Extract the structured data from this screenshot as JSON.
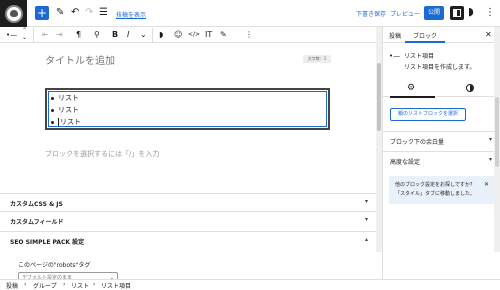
{
  "topbar": {
    "show_blocks_link": "技稿を表示",
    "save_draft": "下書き保存",
    "preview": "プレビュー",
    "publish": "公開"
  },
  "block_toolbar": {
    "bold": "B",
    "italic": "I",
    "code": "</>",
    "text_color": "IT"
  },
  "editor": {
    "title_placeholder": "タイトルを追加",
    "word_count": "文字数：1",
    "list_items": [
      "リスト",
      "リスト",
      "リスト"
    ],
    "block_hint": "ブロックを選択するには「/」を入力"
  },
  "meta_boxes": [
    {
      "label": "カスタムCSS & JS",
      "chevron": "▾"
    },
    {
      "label": "カスタムフィールド",
      "chevron": "▾"
    },
    {
      "label": "SEO SIMPLE PACK 設定",
      "chevron": "▴"
    }
  ],
  "seo": {
    "robots_label": "このページの\"robots\"タグ",
    "robots_value": "デフォルト設定のまま"
  },
  "breadcrumbs": [
    "投稿",
    "グループ",
    "リスト",
    "リスト項目"
  ],
  "sidebar": {
    "tab_post": "投稿",
    "tab_block": "ブロック",
    "close": "✕",
    "block_title": "リスト項目",
    "block_desc": "リスト項目を作成します。",
    "select_parent": "親のリストブロックを選択",
    "panels": [
      {
        "label": "ブロック下の余白量",
        "chevron": "▾"
      },
      {
        "label": "高度な設定",
        "chevron": "▾"
      }
    ],
    "notice_line1": "他のブロック設定をお探しですか？",
    "notice_line2": "「スタイル」タブに移動しました。",
    "notice_close": "✕"
  },
  "colors": {
    "accent": "#1d6bd1",
    "dark": "#1e1e1e"
  }
}
